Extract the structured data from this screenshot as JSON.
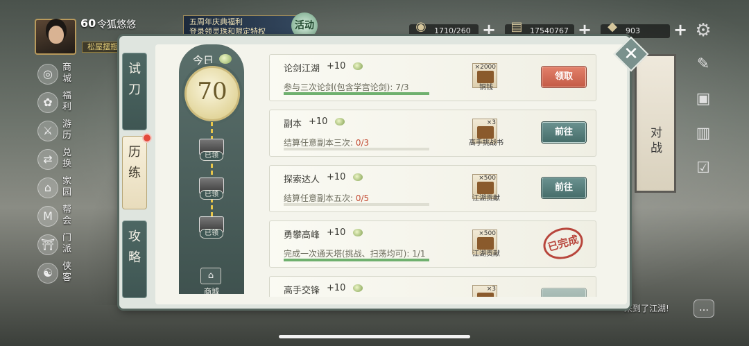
{
  "player": {
    "level": "60",
    "name": "令狐悠悠",
    "title": "松屋摆瓶"
  },
  "banner": {
    "line1": "五周年庆典福利",
    "line2": "登录领灵珠和限定特权"
  },
  "activity": {
    "label": "活动"
  },
  "resources": [
    {
      "icon": "silver-icon",
      "glyph": "◉",
      "value": "1710/260"
    },
    {
      "icon": "wood-icon",
      "glyph": "▤",
      "value": "17540767"
    },
    {
      "icon": "gold-icon",
      "glyph": "◆",
      "value": "903"
    }
  ],
  "side_left": [
    {
      "label": "商城",
      "glyph": "◎",
      "icon": "store-icon"
    },
    {
      "label": "福利",
      "glyph": "✿",
      "icon": "welfare-icon"
    },
    {
      "label": "游历",
      "glyph": "⚔",
      "icon": "travel-icon"
    },
    {
      "label": "兑换",
      "glyph": "⇄",
      "icon": "exchange-icon"
    },
    {
      "label": "家园",
      "glyph": "⌂",
      "icon": "home-icon"
    },
    {
      "label": "帮会",
      "glyph": "M",
      "icon": "guild-icon"
    },
    {
      "label": "门派",
      "glyph": "⛩",
      "icon": "sect-icon"
    },
    {
      "label": "侠客",
      "glyph": "☯",
      "icon": "hero-icon"
    }
  ],
  "side_right": [
    "✎",
    "▣",
    "▥",
    "☑"
  ],
  "scroll_banner": "对战",
  "chat_hint": "来到了江湖!",
  "tabs": {
    "shidao": "试刀",
    "lilian": "历练",
    "gonglue": "攻略"
  },
  "daily": {
    "today_label": "今日",
    "score": "70",
    "chests": [
      {
        "tag": "已领"
      },
      {
        "tag": "已领"
      },
      {
        "tag": "已领"
      }
    ],
    "shop_label": "商城"
  },
  "quests": [
    {
      "title": "论剑江湖",
      "points": "+10",
      "desc": "参与三次论剑(包含学宫论剑): 7/3",
      "desc_pre": "参与三次论剑(包含学宫论剑): ",
      "desc_num": "7/3",
      "num_red": false,
      "progress": 1.0,
      "reward_count": "×2000",
      "reward_name": "铜钱",
      "button": "领取",
      "state": "claim"
    },
    {
      "title": "副本",
      "points": "+10",
      "desc_pre": "结算任意副本三次: ",
      "desc_num": "0/3",
      "num_red": true,
      "progress": 0,
      "reward_count": "×3",
      "reward_name": "高手挑战书",
      "button": "前往",
      "state": "go"
    },
    {
      "title": "探索达人",
      "points": "+10",
      "desc_pre": "结算任意副本五次: ",
      "desc_num": "0/5",
      "num_red": true,
      "progress": 0,
      "reward_count": "×500",
      "reward_name": "江湖贡献",
      "button": "前往",
      "state": "go"
    },
    {
      "title": "勇攀高峰",
      "points": "+10",
      "desc_pre": "完成一次通天塔(挑战、扫荡均可): ",
      "desc_num": "1/1",
      "num_red": false,
      "progress": 1.0,
      "reward_count": "×500",
      "reward_name": "江湖贡献",
      "button": "已完成",
      "state": "done"
    },
    {
      "title": "高手交锋",
      "points": "+10",
      "desc_pre": "",
      "desc_num": "",
      "num_red": false,
      "progress": 0,
      "reward_count": "×3",
      "reward_name": "",
      "button": "",
      "state": "partial"
    }
  ],
  "colors": {
    "accent": "#4f6460",
    "claim": "#c45b46",
    "go": "#466d6a",
    "progress": "#6fb06e",
    "stamp": "#b8463c"
  }
}
